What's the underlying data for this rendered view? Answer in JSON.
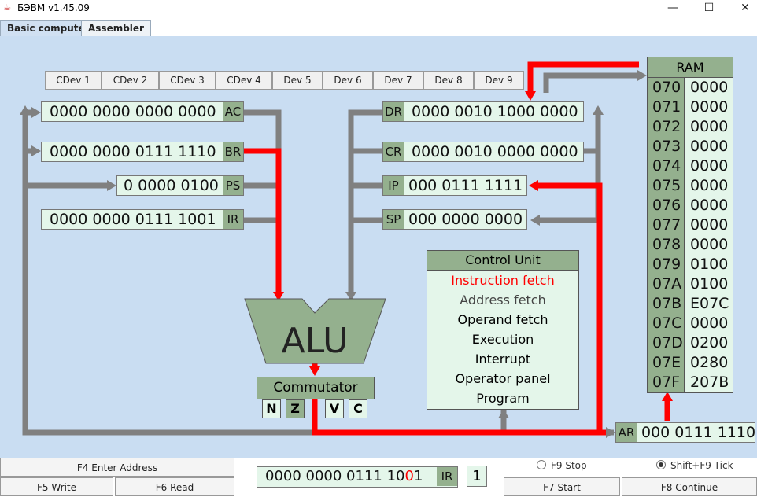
{
  "window": {
    "title": "БЭВМ v1.45.09"
  },
  "tabs": [
    {
      "label": "Basic computer"
    },
    {
      "label": "Assembler"
    }
  ],
  "devices": [
    "CDev 1",
    "CDev 2",
    "CDev 3",
    "CDev 4",
    "Dev 5",
    "Dev 6",
    "Dev 7",
    "Dev 8",
    "Dev 9"
  ],
  "registers": {
    "AC": {
      "name": "AC",
      "value": "0000 0000 0000 0000"
    },
    "BR": {
      "name": "BR",
      "value": "0000 0000 0111 1110"
    },
    "PS": {
      "name": "PS",
      "value": "0 0000 0100"
    },
    "IR": {
      "name": "IR",
      "value": "0000 0000 0111 1001"
    },
    "DR": {
      "name": "DR",
      "value": "0000 0010 1000 0000"
    },
    "CR": {
      "name": "CR",
      "value": "0000 0010 0000 0000"
    },
    "IP": {
      "name": "IP",
      "value": "000 0111 1111"
    },
    "SP": {
      "name": "SP",
      "value": "000 0000 0000"
    },
    "AR": {
      "name": "AR",
      "value": "000 0111 1110"
    }
  },
  "alu": {
    "label": "ALU"
  },
  "commutator": {
    "label": "Commutator"
  },
  "flags": [
    {
      "label": "N",
      "active": false
    },
    {
      "label": "Z",
      "active": true
    },
    {
      "label": "V",
      "active": false
    },
    {
      "label": "C",
      "active": false
    }
  ],
  "control_unit": {
    "title": "Control Unit",
    "items": [
      {
        "label": "Instruction fetch",
        "color": "#ff0000"
      },
      {
        "label": "Address fetch",
        "color": "#444444"
      },
      {
        "label": "Operand fetch",
        "color": "#000000"
      },
      {
        "label": "Execution",
        "color": "#000000"
      },
      {
        "label": "Interrupt",
        "color": "#000000"
      },
      {
        "label": "Operator panel",
        "color": "#000000"
      },
      {
        "label": "Program",
        "color": "#000000"
      }
    ]
  },
  "ram": {
    "title": "RAM",
    "rows": [
      {
        "addr": "070",
        "value": "0000"
      },
      {
        "addr": "071",
        "value": "0000"
      },
      {
        "addr": "072",
        "value": "0000"
      },
      {
        "addr": "073",
        "value": "0000"
      },
      {
        "addr": "074",
        "value": "0000"
      },
      {
        "addr": "075",
        "value": "0000"
      },
      {
        "addr": "076",
        "value": "0000"
      },
      {
        "addr": "077",
        "value": "0000"
      },
      {
        "addr": "078",
        "value": "0000"
      },
      {
        "addr": "079",
        "value": "0100"
      },
      {
        "addr": "07A",
        "value": "0100"
      },
      {
        "addr": "07B",
        "value": "E07C"
      },
      {
        "addr": "07C",
        "value": "0000"
      },
      {
        "addr": "07D",
        "value": "0200"
      },
      {
        "addr": "07E",
        "value": "0280"
      },
      {
        "addr": "07F",
        "value": "207B"
      }
    ]
  },
  "input_register": {
    "prefix": "0000 0000 0111 10",
    "highlight": "0",
    "suffix": "1",
    "name": "IR",
    "counter": "1"
  },
  "buttons": {
    "enter_address": "F4 Enter Address",
    "write": "F5 Write",
    "read": "F6 Read",
    "start": "F7 Start",
    "continue": "F8 Continue"
  },
  "radios": {
    "stop": "F9 Stop",
    "tick": "Shift+F9 Tick",
    "selected": "tick"
  },
  "colors": {
    "background": "#c9ddf2",
    "register_bg": "#e4f6ea",
    "register_label": "#94b08e",
    "active_bus": "#ff0000",
    "bus": "#808080"
  }
}
